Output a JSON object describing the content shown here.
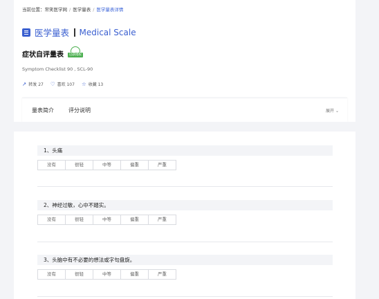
{
  "breadcrumb": {
    "prefix": "当前位置：",
    "items": [
      "常笑医学网",
      "医学量表",
      "医学量表详情"
    ]
  },
  "header": {
    "title_cn": "医学量表",
    "title_en": "Medical Scale"
  },
  "scale": {
    "name": "症状自评量表",
    "badge": "已获授权",
    "subtitle": "Symptom Checklist 90 , SCL-90"
  },
  "stats": {
    "share": "转发 27",
    "like": "喜欢 107",
    "favorite": "收藏 13"
  },
  "tabs": {
    "intro": "量表简介",
    "scoring": "评分说明",
    "expand": "展开"
  },
  "options": [
    "没有",
    "很轻",
    "中等",
    "偏重",
    "严重"
  ],
  "questions": [
    {
      "label": "1、头痛"
    },
    {
      "label": "2、神经过敏，心中不踏实。"
    },
    {
      "label": "3、头脑中有不必要的想法或字句盘旋。"
    }
  ],
  "colors": {
    "accent": "#3a5fd0",
    "badge": "#4caf50",
    "background": "#f3f4f7"
  }
}
